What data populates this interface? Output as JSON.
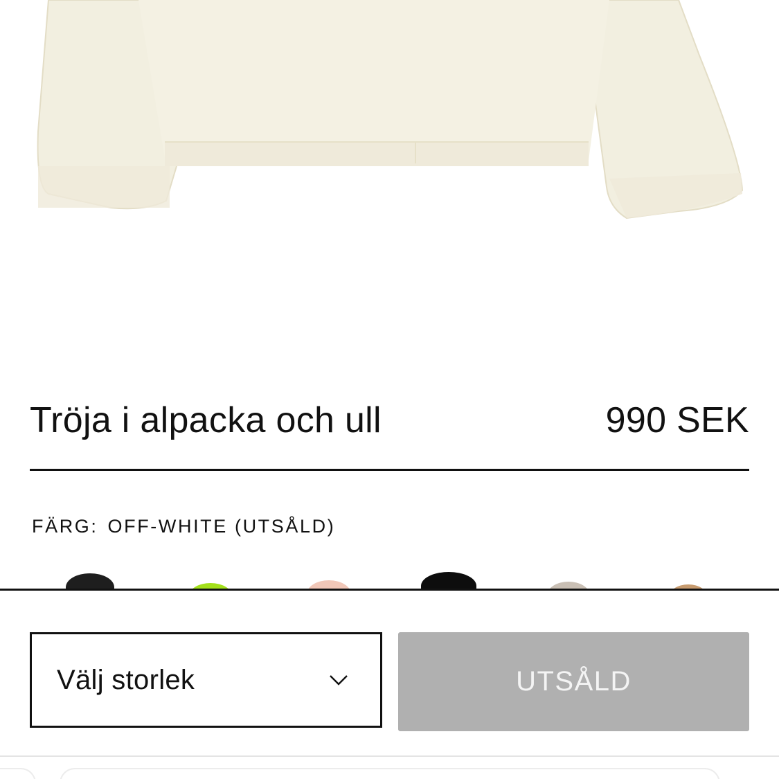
{
  "product": {
    "image_alt": "Off-white sweater",
    "title": "Tröja i alpacka och ull",
    "price": "990 SEK"
  },
  "color": {
    "label": "FÄRG:",
    "value": "OFF-WHITE (UTSÅLD)",
    "swatches": [
      {
        "name": "black",
        "color": "#1e1e1e"
      },
      {
        "name": "lime",
        "color": "#a3e01a"
      },
      {
        "name": "pink",
        "color": "#f1c7b8"
      },
      {
        "name": "black-2",
        "color": "#0d0d0d"
      },
      {
        "name": "taupe",
        "color": "#c9bfb4"
      },
      {
        "name": "camel",
        "color": "#c79b6f"
      }
    ]
  },
  "actions": {
    "size_select_placeholder": "Välj storlek",
    "soldout_label": "UTSÅLD"
  },
  "colors": {
    "sweater": "#f2efe0",
    "sweater_shadow": "#e6e1cc",
    "soldout_bg": "#b0b0b0",
    "text": "#111111"
  },
  "icons": {
    "size_select": "chevron-down-icon"
  }
}
